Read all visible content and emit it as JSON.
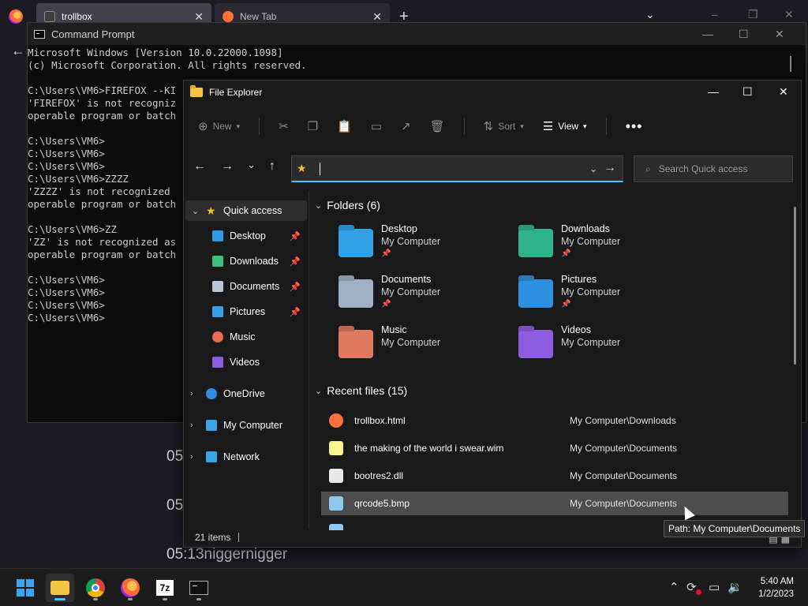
{
  "browser": {
    "tabs": [
      {
        "label": "trollbox",
        "active": true
      },
      {
        "label": "New Tab",
        "active": false
      }
    ],
    "new_tab_label": "+",
    "list_tabs_icon": "chevron-down-icon",
    "min": "–",
    "max": "❐",
    "close": "✕",
    "back": "←"
  },
  "background_log": [
    "05",
    "05",
    "05:13niggernigger"
  ],
  "cmd": {
    "title": "Command Prompt",
    "min": "—",
    "max": "☐",
    "close": "✕",
    "lines": [
      "Microsoft Windows [Version 10.0.22000.1098]",
      "(c) Microsoft Corporation. All rights reserved.",
      "",
      "C:\\Users\\VM6>FIREFOX --KI",
      "'FIREFOX' is not recogniz",
      "operable program or batch",
      "",
      "C:\\Users\\VM6>",
      "C:\\Users\\VM6>",
      "C:\\Users\\VM6>",
      "C:\\Users\\VM6>ZZZZ",
      "'ZZZZ' is not recognized",
      "operable program or batch",
      "",
      "C:\\Users\\VM6>ZZ",
      "'ZZ' is not recognized as",
      "operable program or batch",
      "",
      "C:\\Users\\VM6>",
      "C:\\Users\\VM6>",
      "C:\\Users\\VM6>",
      "C:\\Users\\VM6>"
    ]
  },
  "explorer": {
    "title": "File Explorer",
    "min": "—",
    "max": "☐",
    "close": "✕",
    "cmdbar": {
      "new": "New",
      "sort": "Sort",
      "view": "View",
      "more": "•••"
    },
    "nav": {
      "back": "←",
      "forward": "→",
      "recent": "⌄",
      "up": "↑",
      "go": "→",
      "dropdown": "⌄"
    },
    "address_value": "",
    "search_placeholder": "Search Quick access",
    "sidebar": [
      {
        "label": "Quick access",
        "icon": "star-icon",
        "color": "#f2c12e",
        "selected": true,
        "expanded": true
      },
      {
        "label": "Desktop",
        "icon": "desktop-icon",
        "color": "#2b9be3",
        "pinned": true
      },
      {
        "label": "Downloads",
        "icon": "downloads-icon",
        "color": "#3cbf7e",
        "pinned": true
      },
      {
        "label": "Documents",
        "icon": "documents-icon",
        "color": "#bcc7d6",
        "pinned": true
      },
      {
        "label": "Pictures",
        "icon": "pictures-icon",
        "color": "#3a9de8",
        "pinned": true
      },
      {
        "label": "Music",
        "icon": "music-icon",
        "color": "#e86d4f"
      },
      {
        "label": "Videos",
        "icon": "videos-icon",
        "color": "#8a5ce0"
      },
      {
        "label": "OneDrive",
        "icon": "onedrive-icon",
        "color": "#2f8ee0"
      },
      {
        "label": "My Computer",
        "icon": "computer-icon",
        "color": "#3aa6e8"
      },
      {
        "label": "Network",
        "icon": "network-icon",
        "color": "#3aa6e8"
      }
    ],
    "folders_header": "Folders (6)",
    "folders": [
      {
        "name": "Desktop",
        "loc": "My Computer",
        "pinned": true,
        "color": "#2f9fe6",
        "icon": "desktop-folder-icon"
      },
      {
        "name": "Downloads",
        "loc": "My Computer",
        "pinned": true,
        "color": "#2fb38a",
        "icon": "downloads-folder-icon"
      },
      {
        "name": "Documents",
        "loc": "My Computer",
        "pinned": true,
        "color": "#9fb0c6",
        "icon": "documents-folder-icon"
      },
      {
        "name": "Pictures",
        "loc": "My Computer",
        "pinned": true,
        "color": "#2f8fe0",
        "icon": "pictures-folder-icon"
      },
      {
        "name": "Music",
        "loc": "My Computer",
        "pinned": false,
        "color": "#e07a5f",
        "icon": "music-folder-icon"
      },
      {
        "name": "Videos",
        "loc": "My Computer",
        "pinned": false,
        "color": "#8e5ce0",
        "icon": "videos-folder-icon"
      }
    ],
    "recent_header": "Recent files (15)",
    "recent": [
      {
        "name": "trollbox.html",
        "path": "My Computer\\Downloads",
        "icon": "firefox-file-icon",
        "color": "#ff7139"
      },
      {
        "name": "the making of the world i swear.wim",
        "path": "My Computer\\Documents",
        "icon": "wim-file-icon",
        "color": "#f7f48b"
      },
      {
        "name": "bootres2.dll",
        "path": "My Computer\\Documents",
        "icon": "dll-file-icon",
        "color": "#e8e8e8"
      },
      {
        "name": "qrcode5.bmp",
        "path": "My Computer\\Documents",
        "icon": "bmp-file-icon",
        "color": "#8fc8f0",
        "highlighted": true
      },
      {
        "name": "",
        "path": "",
        "icon": "bmp-file-icon",
        "color": "#8fc8f0"
      }
    ],
    "status_count": "21 items",
    "tooltip": "Path: My Computer\\Documents"
  },
  "taskbar": {
    "apps": [
      {
        "name": "start-button",
        "icon": "windows-logo-icon"
      },
      {
        "name": "file-explorer-app",
        "icon": "folder-icon",
        "active": true
      },
      {
        "name": "chrome-app",
        "icon": "chrome-icon"
      },
      {
        "name": "firefox-app",
        "icon": "firefox-icon"
      },
      {
        "name": "7zip-app",
        "icon": "7zip-icon",
        "label": "7z"
      },
      {
        "name": "terminal-app",
        "icon": "terminal-icon"
      }
    ],
    "tray": {
      "chevron": "^",
      "sync": "⟳",
      "network": "🖥",
      "volume": "🔊"
    },
    "time": "5:40 AM",
    "date": "1/2/2023"
  }
}
